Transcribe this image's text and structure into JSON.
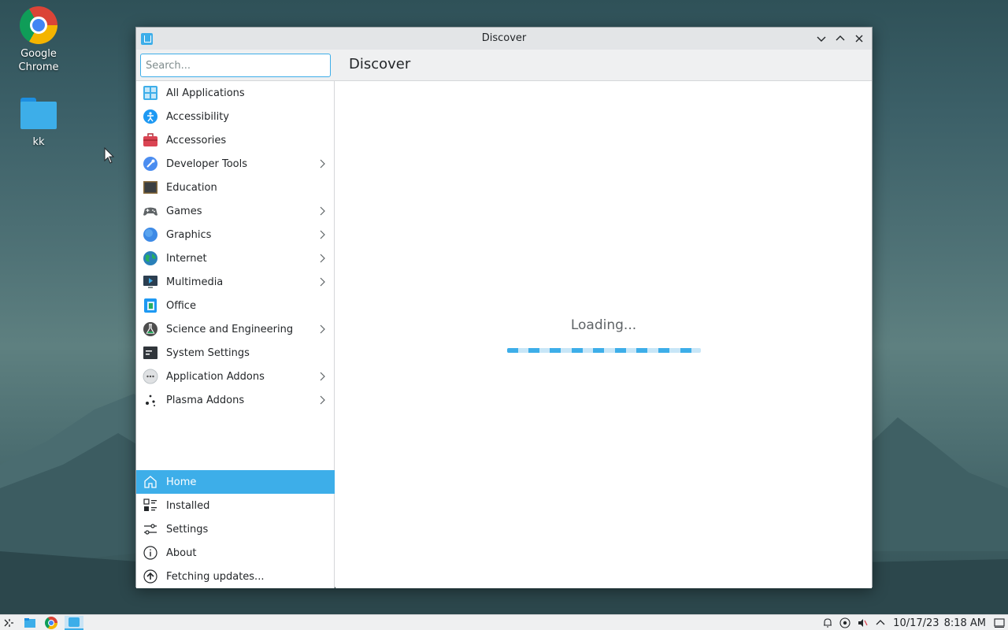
{
  "desktop": {
    "icons": [
      {
        "label": "Google\nChrome",
        "line1": "Google",
        "line2": "Chrome",
        "icon": "chrome-icon"
      },
      {
        "label": "kk",
        "icon": "folder-icon"
      }
    ]
  },
  "window": {
    "title": "Discover",
    "page_title": "Discover",
    "controls": [
      "minimize-icon",
      "maximize-icon",
      "close-icon"
    ]
  },
  "search": {
    "placeholder": "Search...",
    "value": ""
  },
  "categories": [
    {
      "label": "All Applications",
      "icon": "all-applications-icon",
      "has_submenu": false
    },
    {
      "label": "Accessibility",
      "icon": "accessibility-icon",
      "has_submenu": false
    },
    {
      "label": "Accessories",
      "icon": "accessories-icon",
      "has_submenu": false
    },
    {
      "label": "Developer Tools",
      "icon": "developer-tools-icon",
      "has_submenu": true
    },
    {
      "label": "Education",
      "icon": "education-icon",
      "has_submenu": false
    },
    {
      "label": "Games",
      "icon": "games-icon",
      "has_submenu": true
    },
    {
      "label": "Graphics",
      "icon": "graphics-icon",
      "has_submenu": true
    },
    {
      "label": "Internet",
      "icon": "internet-icon",
      "has_submenu": true
    },
    {
      "label": "Multimedia",
      "icon": "multimedia-icon",
      "has_submenu": true
    },
    {
      "label": "Office",
      "icon": "office-icon",
      "has_submenu": false
    },
    {
      "label": "Science and Engineering",
      "icon": "science-icon",
      "has_submenu": true
    },
    {
      "label": "System Settings",
      "icon": "system-settings-icon",
      "has_submenu": false
    },
    {
      "label": "Application Addons",
      "icon": "application-addons-icon",
      "has_submenu": true
    },
    {
      "label": "Plasma Addons",
      "icon": "plasma-addons-icon",
      "has_submenu": true
    }
  ],
  "bottom_nav": [
    {
      "label": "Home",
      "icon": "home-icon",
      "active": true
    },
    {
      "label": "Installed",
      "icon": "installed-icon",
      "active": false
    },
    {
      "label": "Settings",
      "icon": "settings-icon",
      "active": false
    },
    {
      "label": "About",
      "icon": "about-icon",
      "active": false
    },
    {
      "label": "Fetching updates...",
      "icon": "update-icon",
      "active": false
    }
  ],
  "main": {
    "loading_text": "Loading..."
  },
  "taskbar": {
    "date": "10/17/23",
    "time": "8:18 AM",
    "apps": [
      "launcher-icon",
      "file-manager-icon",
      "chrome-icon",
      "discover-icon"
    ]
  },
  "colors": {
    "accent": "#3daee9",
    "window_bg": "#eff0f1"
  }
}
